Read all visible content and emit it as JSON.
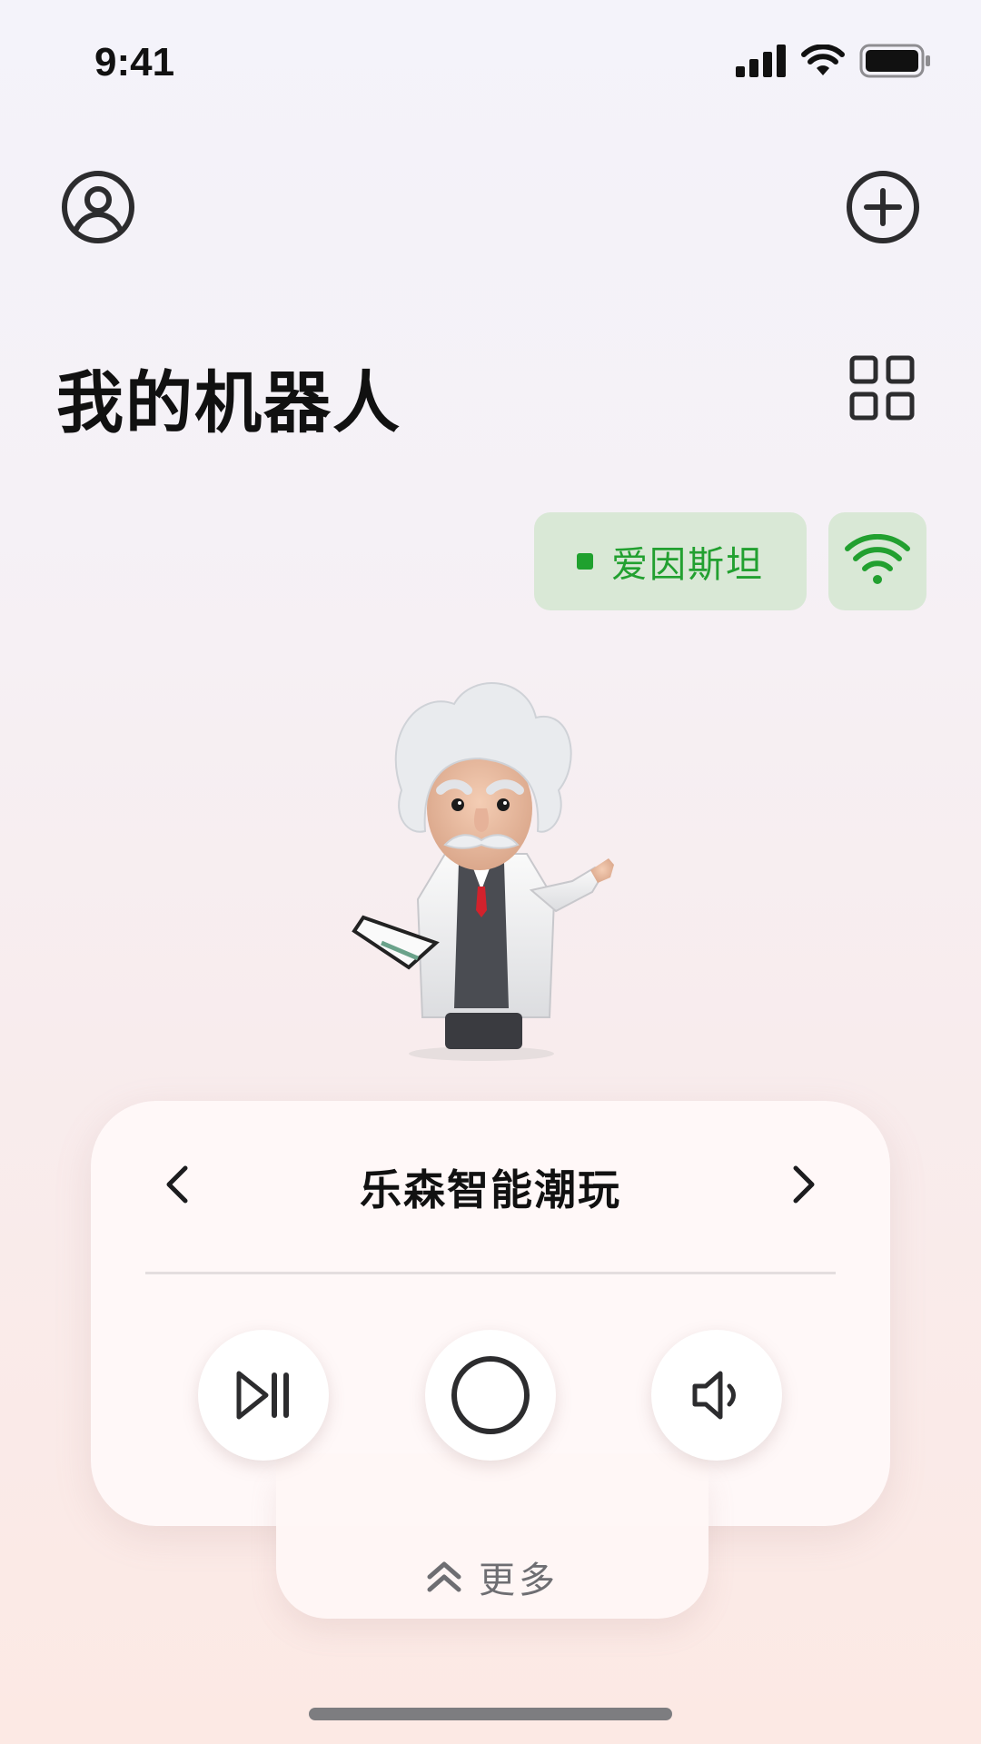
{
  "status_bar": {
    "time": "9:41"
  },
  "header": {
    "title": "我的机器人"
  },
  "device": {
    "name": "爱因斯坦",
    "status_color": "#1fa12e",
    "wifi_color": "#22a030"
  },
  "player": {
    "track_title": "乐森智能潮玩"
  },
  "more": {
    "label": "更多"
  },
  "icons": [
    "profile-icon",
    "add-icon",
    "grid-icon",
    "wifi-icon",
    "chevron-left-icon",
    "chevron-right-icon",
    "play-pause-icon",
    "record-icon",
    "volume-icon",
    "chevron-double-up-icon"
  ],
  "colors": {
    "accent_green": "#22a030",
    "chip_bg": "#d9e8d6",
    "text": "#111111"
  }
}
